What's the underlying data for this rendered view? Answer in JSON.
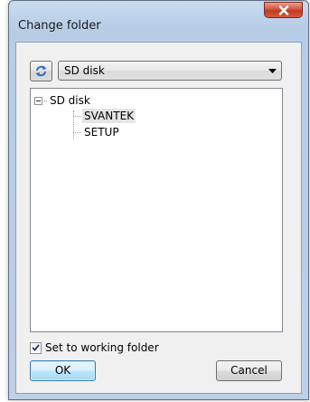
{
  "window": {
    "title": "Change folder",
    "close_icon": "close-icon"
  },
  "toolbar": {
    "refresh_icon": "refresh-icon",
    "drive_select": {
      "selected": "SD disk",
      "chevron_icon": "chevron-down-icon"
    }
  },
  "tree": {
    "root": {
      "label": "SD disk",
      "expanded": true,
      "children": [
        {
          "label": "SVANTEK",
          "selected": true
        },
        {
          "label": "SETUP",
          "selected": false
        }
      ]
    }
  },
  "working_folder": {
    "label": "Set to working folder",
    "checked": true
  },
  "buttons": {
    "ok": "OK",
    "cancel": "Cancel"
  },
  "colors": {
    "title_bar": "#bcd0e8",
    "close_button": "#c9452c",
    "selection": "#e5e5e5",
    "default_button_border": "#3c7fb1"
  }
}
